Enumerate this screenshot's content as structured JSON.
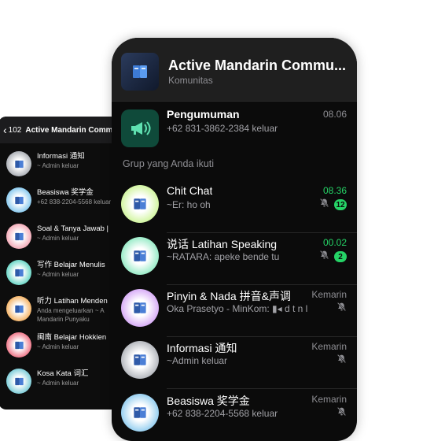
{
  "back_phone": {
    "back_label": "102",
    "title": "Active Mandarin Comm",
    "items": [
      {
        "name": "Informasi 通知",
        "sub": "~ Admin keluar",
        "sub2": "",
        "color": "#8a8f98"
      },
      {
        "name": "Beasiswa 奖学金",
        "sub": "+62 838-2204-5568 keluar",
        "sub2": "",
        "color": "#5ab4e8"
      },
      {
        "name": "Soal & Tanya Jawab |",
        "sub": "~ Admin keluar",
        "sub2": "",
        "color": "#ef8a9c"
      },
      {
        "name": "写作 Belajar Menulis",
        "sub": "~ Admin keluar",
        "sub2": "",
        "color": "#2fc6b0"
      },
      {
        "name": "听力 Latihan Menden",
        "sub": "Anda mengeluarkan ~ A",
        "sub2": "Mandarin Punyaku",
        "color": "#f0962a"
      },
      {
        "name": "闽南 Belajar Hokkien",
        "sub": "~ Admin keluar",
        "sub2": "",
        "color": "#e8415a"
      },
      {
        "name": "Kosa Kata 词汇",
        "sub": "~ Admin keluar",
        "sub2": "",
        "color": "#49b9c9"
      }
    ]
  },
  "front_phone": {
    "title": "Active Mandarin Commu...",
    "subtitle": "Komunitas",
    "announcement": {
      "name": "Pengumuman",
      "sub": "+62 831-3862-2384 keluar",
      "time": "08.06"
    },
    "section_label": "Grup yang Anda ikuti",
    "chats": [
      {
        "name": "Chit Chat",
        "sub": "~Er: ho oh",
        "time": "08.36",
        "time_green": true,
        "muted": true,
        "badge": "12",
        "color": "#b8f06a"
      },
      {
        "name": "说话 Latihan Speaking",
        "sub": "~RATARA: apeke bende tu",
        "time": "00.02",
        "time_green": true,
        "muted": true,
        "badge": "2",
        "color": "#5fe0a8"
      },
      {
        "name": "Pinyin & Nada 拼音&声调",
        "sub": "Oka Prasetyo - MinKom: ▮◂ d t n l",
        "time": "Kemarin",
        "time_green": false,
        "muted": true,
        "badge": "",
        "color": "#c27ef2"
      },
      {
        "name": "Informasi 通知",
        "sub": "~Admin keluar",
        "time": "Kemarin",
        "time_green": false,
        "muted": true,
        "badge": "",
        "color": "#8a8f98"
      },
      {
        "name": "Beasiswa 奖学金",
        "sub": "+62 838-2204-5568 keluar",
        "time": "Kemarin",
        "time_green": false,
        "muted": true,
        "badge": "",
        "color": "#5ab4e8"
      }
    ]
  },
  "colors": {
    "accent_green": "#25d366",
    "background": "#0b0b0b",
    "header": "#1f1f1f"
  },
  "icons": {
    "megaphone": "megaphone-icon",
    "mute": "bell-slash-icon",
    "back": "chevron-left-icon"
  }
}
